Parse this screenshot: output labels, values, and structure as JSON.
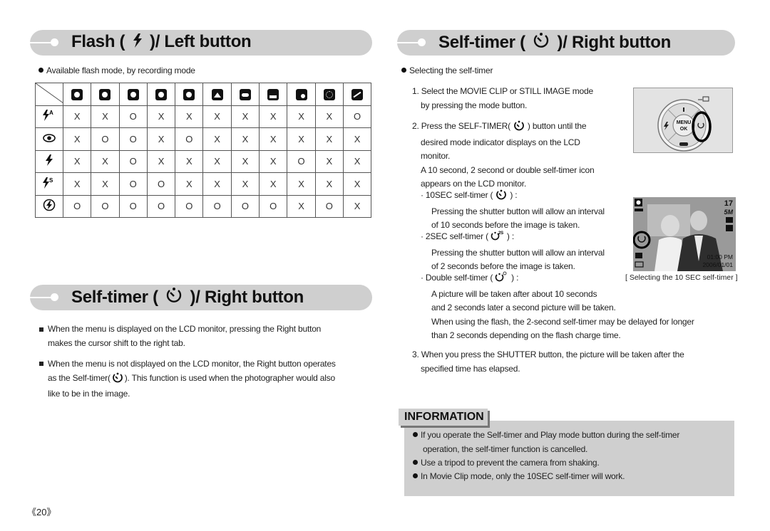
{
  "left_section": {
    "header_title_part1": "Flash (",
    "header_icon": "flash-icon",
    "header_title_part2": ")/ Left button",
    "intro": "Available flash mode, by recording mode",
    "table": {
      "columns": [
        "movie-clip-icon",
        "auto-mode-icon",
        "program-mode-icon",
        "night-scene-icon",
        "portrait-icon",
        "landscape-icon",
        "text-icon",
        "sunset-icon",
        "backlight-icon",
        "fireworks-icon",
        "beach-snow-icon"
      ],
      "rows": [
        {
          "icon": "auto-flash-icon",
          "values": [
            "X",
            "X",
            "O",
            "X",
            "X",
            "X",
            "X",
            "X",
            "X",
            "X",
            "O"
          ]
        },
        {
          "icon": "red-eye-icon",
          "values": [
            "X",
            "O",
            "O",
            "X",
            "O",
            "X",
            "X",
            "X",
            "X",
            "X",
            "X"
          ]
        },
        {
          "icon": "fill-flash-icon",
          "values": [
            "X",
            "X",
            "O",
            "X",
            "X",
            "X",
            "X",
            "X",
            "O",
            "X",
            "X"
          ]
        },
        {
          "icon": "slow-sync-icon",
          "values": [
            "X",
            "X",
            "O",
            "O",
            "X",
            "X",
            "X",
            "X",
            "X",
            "X",
            "X"
          ]
        },
        {
          "icon": "flash-off-icon",
          "values": [
            "O",
            "O",
            "O",
            "O",
            "O",
            "O",
            "O",
            "O",
            "X",
            "O",
            "X"
          ]
        }
      ]
    }
  },
  "left_lower_section": {
    "header_title_part1": "Self-timer (",
    "header_icon": "self-timer-icon",
    "header_title_part2": ")/ Right button",
    "bullets": [
      [
        "When the menu is displayed on the LCD monitor, pressing the Right button",
        "makes the cursor shift to the right tab."
      ],
      [
        "When the menu is not displayed on the LCD monitor, the Right button operates",
        "as the Self-timer(",
        "). This function is used when the photographer would also",
        "like to be in the image."
      ]
    ]
  },
  "right_section": {
    "header_title_part1": "Self-timer (",
    "header_icon": "self-timer-icon",
    "header_title_part2": ")/ Right button",
    "intro": "Selecting the self-timer",
    "step1": [
      "1. Select the MOVIE CLIP or STILL IMAGE mode",
      "by pressing the mode button."
    ],
    "step2": [
      "2. Press the SELF-TIMER(",
      ") button until the",
      "desired mode indicator displays on the LCD",
      "monitor.",
      "A 10 second, 2 second or double self-timer icon",
      "appears on the LCD monitor."
    ],
    "timer_10": [
      "· 10SEC self-timer (",
      ") :",
      "Pressing the shutter button will allow an interval",
      "of 10 seconds before the image is taken."
    ],
    "timer_2": [
      "· 2SEC self-timer (",
      ") :",
      "Pressing the shutter button will allow an interval",
      "of 2 seconds before the image is taken."
    ],
    "timer_double": [
      "· Double self-timer (",
      ") :",
      "A picture will be taken after about 10 seconds",
      "and 2 seconds later a second picture will be taken.",
      "When using the flash, the 2-second self-timer may be delayed for longer",
      "than 2 seconds depending on the flash charge time."
    ],
    "step3": [
      "3. When you press the SHUTTER button, the picture will be taken after the",
      "specified time has elapsed."
    ],
    "camera_button_labels": {
      "menu": "MENU",
      "ok": "OK"
    },
    "lcd": {
      "shots": "17",
      "size": "5M",
      "time": "01:00 PM",
      "date": "2006/01/01"
    },
    "caption": "[ Selecting the 10 SEC self-timer ]"
  },
  "information": {
    "label": "INFORMATION",
    "items": [
      [
        "If you operate the Self-timer and Play mode button during the self-timer",
        "operation, the self-timer function is cancelled."
      ],
      [
        "Use a tripod to prevent the camera from shaking."
      ],
      [
        "In Movie Clip mode, only the 10SEC self-timer will work."
      ]
    ]
  },
  "page_number": "《20》"
}
